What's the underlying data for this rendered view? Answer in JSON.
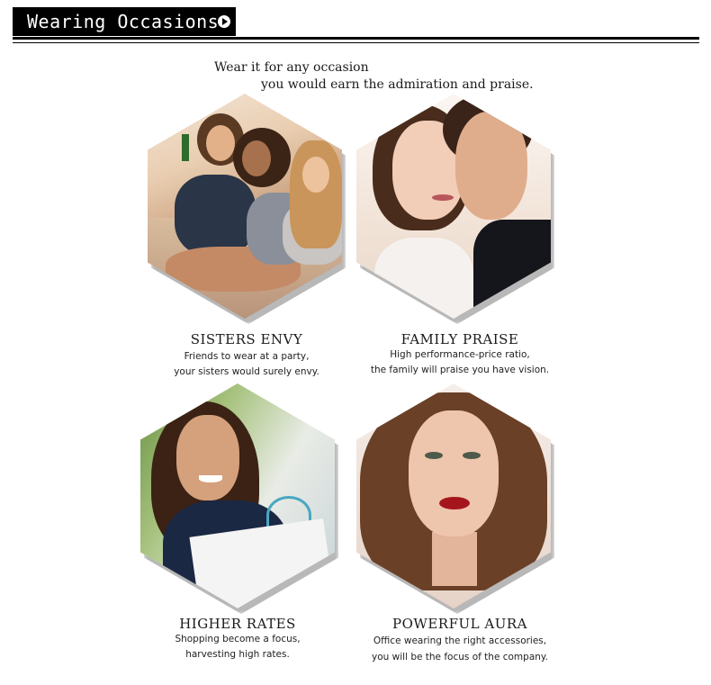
{
  "header": {
    "title": "Wearing Occasions"
  },
  "intro": {
    "line1": "Wear it for any occasion",
    "line2": "you would earn the admiration and praise."
  },
  "cards": [
    {
      "title": "SISTERS ENVY",
      "line1": "Friends to wear at a party,",
      "line2": "your sisters would surely envy."
    },
    {
      "title": "FAMILY PRAISE",
      "line1": "High performance-price ratio,",
      "line2": "the family will praise you have vision."
    },
    {
      "title": "HIGHER RATES",
      "line1": "Shopping become a focus,",
      "line2": "harvesting high rates."
    },
    {
      "title": "POWERFUL AURA",
      "line1": "Office wearing the right accessories,",
      "line2": "you will be the focus of the company."
    }
  ]
}
